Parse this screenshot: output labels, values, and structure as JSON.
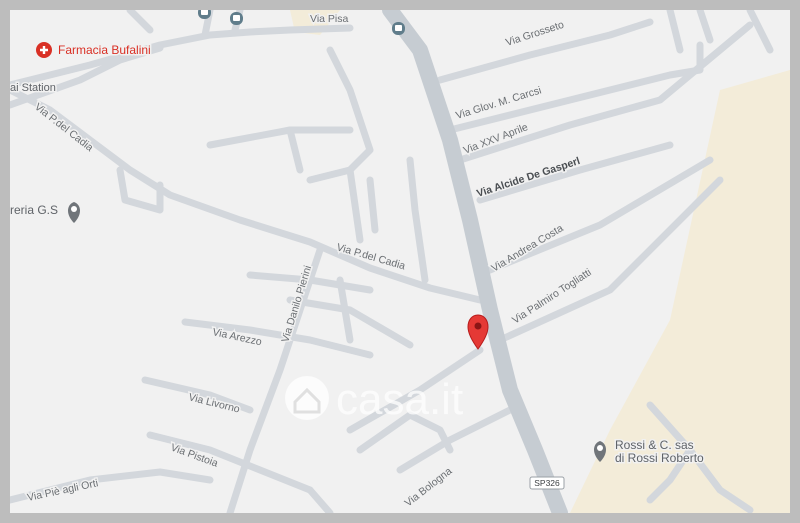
{
  "map": {
    "colors": {
      "land": "#f1f1f1",
      "road": "#d3d7dc",
      "main_road": "#c6ccd2",
      "park": "#f3ecd9",
      "label": "#6b6f73",
      "pharmacy": "#d93025",
      "marker": "#e53935",
      "poi_grey": "#70757a",
      "route_badge": "#1a73e8"
    },
    "road_labels": {
      "via_pisa": "Via Pisa",
      "via_grosseto": "Via Grosseto",
      "via_glov_carcsi": "Via Glov. M. Carcsi",
      "via_xxv_aprile": "Via XXV Aprile",
      "via_alcide": "Via Alcide De Gasperl",
      "via_p_cadia_upper": "Via P.del Cadia",
      "via_p_cadia_mid": "Via P.del Cadia",
      "via_andrea_costa": "Via Andrea Costa",
      "via_palmiro_togliatti": "Via Palmiro Togliatti",
      "via_danilo_pierini": "Via Danilo Pierini",
      "via_arezzo": "Via Arezzo",
      "via_livorno": "Via Livorno",
      "via_pistoia": "Via Pistoia",
      "via_bologna": "Via Bologna",
      "via_pie_agli_orti": "Via Piè agli Orti"
    },
    "pois": {
      "farmacia": "Farmacia Bufalini",
      "station": "ai Station",
      "reria": "reria G.S",
      "rossi_line1": "Rossi & C. sas",
      "rossi_line2": "di Rossi Roberto"
    },
    "icons": {
      "pharmacy": "pharmacy-icon",
      "bus": "bus-stop-icon",
      "place": "place-icon",
      "marker": "location-marker-icon"
    },
    "route_badge": "SP326",
    "watermark": "casa.it"
  }
}
